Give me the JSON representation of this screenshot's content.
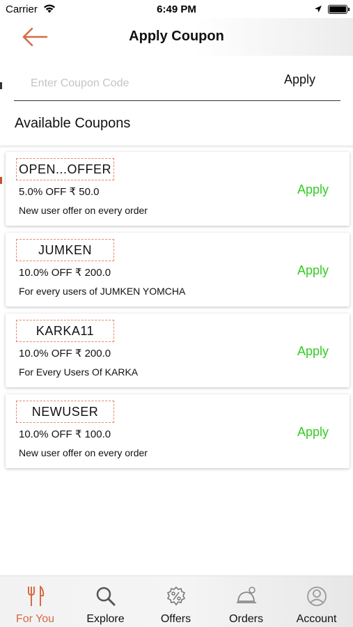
{
  "status_bar": {
    "carrier": "Carrier",
    "time": "6:49 PM"
  },
  "header": {
    "title": "Apply Coupon",
    "back_icon": "arrow-left-icon"
  },
  "coupon_entry": {
    "placeholder": "Enter Coupon Code",
    "value": "",
    "apply_label": "Apply"
  },
  "section_title": "Available Coupons",
  "coupons": [
    {
      "code": "OPEN...OFFER",
      "discount": "5.0% OFF ₹ 50.0",
      "description": "New user offer on every order",
      "apply_label": "Apply"
    },
    {
      "code": "JUMKEN",
      "discount": "10.0% OFF ₹ 200.0",
      "description": "For every users of JUMKEN YOMCHA",
      "apply_label": "Apply"
    },
    {
      "code": "KARKA11",
      "discount": "10.0% OFF ₹ 200.0",
      "description": "For Every Users Of KARKA",
      "apply_label": "Apply"
    },
    {
      "code": "NEWUSER",
      "discount": "10.0% OFF ₹ 100.0",
      "description": "New user offer on every order",
      "apply_label": "Apply"
    }
  ],
  "tabs": [
    {
      "label": "For You",
      "icon": "fork-knife-icon",
      "active": true
    },
    {
      "label": "Explore",
      "icon": "search-icon",
      "active": false
    },
    {
      "label": "Offers",
      "icon": "discount-badge-icon",
      "active": false
    },
    {
      "label": "Orders",
      "icon": "cloche-icon",
      "active": false
    },
    {
      "label": "Account",
      "icon": "user-icon",
      "active": false
    }
  ],
  "colors": {
    "accent": "#d56a45",
    "apply_green": "#33cc22",
    "coupon_border": "#e28864"
  }
}
